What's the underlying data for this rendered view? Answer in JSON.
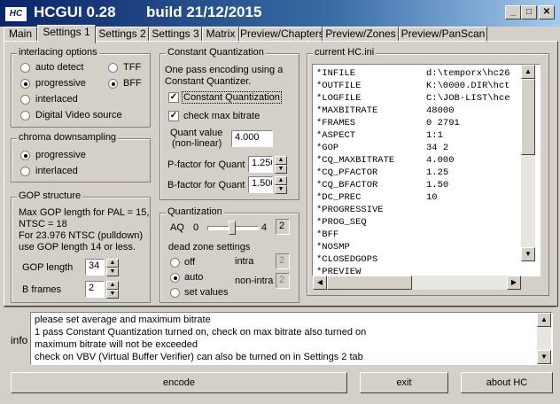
{
  "window": {
    "title": "HCGUI 0.28",
    "build": "build 21/12/2015",
    "icon_text": "HC",
    "controls": {
      "minimize": "_",
      "maximize": "□",
      "close": "✕"
    }
  },
  "tabs": [
    {
      "label": "Main",
      "active": false
    },
    {
      "label": "Settings 1",
      "active": true
    },
    {
      "label": "Settings 2",
      "active": false
    },
    {
      "label": "Settings 3",
      "active": false
    },
    {
      "label": "Matrix",
      "active": false
    },
    {
      "label": "Preview/Chapters",
      "active": false
    },
    {
      "label": "Preview/Zones",
      "active": false
    },
    {
      "label": "Preview/PanScan",
      "active": false
    }
  ],
  "interlacing": {
    "title": "interlacing options",
    "auto_detect": "auto detect",
    "progressive": "progressive",
    "tff": "TFF",
    "bff": "BFF",
    "interlaced": "interlaced",
    "dvs": "Digital Video source",
    "selected_mode": "progressive",
    "selected_field": "BFF"
  },
  "chroma": {
    "title": "chroma downsampling",
    "progressive": "progressive",
    "interlaced": "interlaced",
    "selected": "progressive"
  },
  "gop": {
    "title": "GOP structure",
    "info_lines": [
      "Max GOP length for PAL = 15,",
      "NTSC = 18",
      "For 23.976 NTSC (pulldown)",
      "use GOP length 14 or less."
    ],
    "length_label": "GOP length",
    "length_value": "34",
    "bframes_label": "B frames",
    "bframes_value": "2"
  },
  "cq": {
    "title": "Constant Quantization",
    "desc_lines": [
      "One pass encoding using a",
      "Constant Quantizer."
    ],
    "cq_check_label": "Constant Quantization",
    "cq_checked": true,
    "maxbr_label": "check max bitrate",
    "maxbr_checked": true,
    "quant_label_1": "Quant value",
    "quant_label_2": "(non-linear)",
    "quant_value": "4.000",
    "pfactor_label": "P-factor for Quant",
    "pfactor_value": "1.250",
    "bfactor_label": "B-factor for Quant",
    "bfactor_value": "1.500"
  },
  "quantization": {
    "title": "Quantization",
    "aq_label": "AQ",
    "aq_min": "0",
    "aq_max": "4",
    "aq_value": "2",
    "aq_level": 0.5,
    "deadzone_label": "dead zone settings",
    "off": "off",
    "auto": "auto",
    "set_values": "set values",
    "selected": "auto",
    "intra_label": "intra",
    "intra_value": "2",
    "nonintra_label": "non-intra",
    "nonintra_value": "2"
  },
  "hc_ini": {
    "title": "current HC.ini",
    "lines": [
      {
        "key": "*INFILE",
        "val": "d:\\temporx\\hc26"
      },
      {
        "key": "*OUTFILE",
        "val": "K:\\0000.DIR\\hct"
      },
      {
        "key": "*LOGFILE",
        "val": "C:\\JOB-LIST\\hce"
      },
      {
        "key": "*MAXBITRATE",
        "val": "48000"
      },
      {
        "key": "*FRAMES",
        "val": "0 2791"
      },
      {
        "key": "*ASPECT",
        "val": "1:1"
      },
      {
        "key": "*GOP",
        "val": "34 2"
      },
      {
        "key": "*CQ_MAXBITRATE",
        "val": "4.000"
      },
      {
        "key": "*CQ_PFACTOR",
        "val": "1.25"
      },
      {
        "key": "*CQ_BFACTOR",
        "val": "1.50"
      },
      {
        "key": "*DC_PREC",
        "val": "10"
      },
      {
        "key": "*PROGRESSIVE",
        "val": ""
      },
      {
        "key": "*PROG_SEQ",
        "val": ""
      },
      {
        "key": "*BFF",
        "val": ""
      },
      {
        "key": "*NOSMP",
        "val": ""
      },
      {
        "key": "*CLOSEDGOPS",
        "val": ""
      },
      {
        "key": "*PREVIEW",
        "val": ""
      }
    ]
  },
  "info": {
    "label": "info",
    "lines": [
      "please set average and maximum bitrate",
      "1 pass Constant Quantization turned on, check on max bitrate also turned on",
      "maximum bitrate will not be exceeded",
      "check on VBV (Virtual Buffer Verifier) can also be turned on in Settings 2 tab"
    ]
  },
  "buttons": {
    "encode": "encode",
    "exit": "exit",
    "about": "about HC"
  }
}
